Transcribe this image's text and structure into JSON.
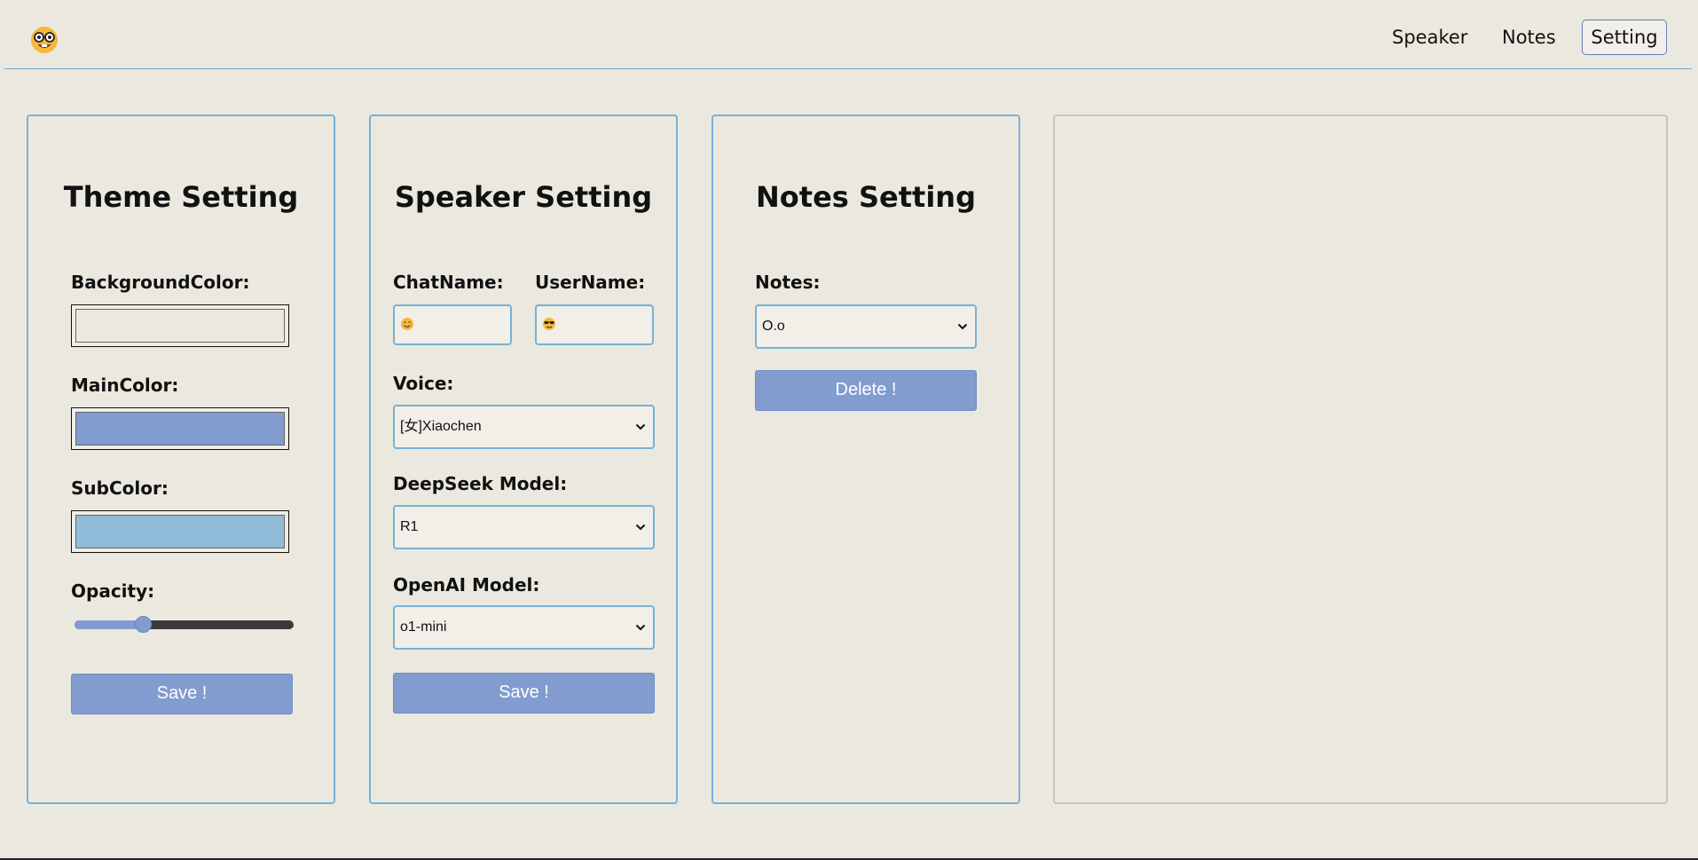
{
  "nav": {
    "items": [
      {
        "label": "Speaker"
      },
      {
        "label": "Notes"
      },
      {
        "label": "Setting",
        "active": true
      }
    ],
    "logo_icon": "nerd-face-icon"
  },
  "theme": {
    "title": "Theme Setting",
    "background_label": "BackgroundColor:",
    "background_color": "#ebe9df",
    "main_label": "MainColor:",
    "main_color": "#839ccf",
    "sub_label": "SubColor:",
    "sub_color": "#8fbdd9",
    "opacity_label": "Opacity:",
    "opacity_value": 0.3,
    "save_label": "Save !"
  },
  "speaker": {
    "title": "Speaker Setting",
    "chatname_label": "ChatName:",
    "chatname_icon": "smiling-face-icon",
    "username_label": "UserName:",
    "username_icon": "sunglasses-face-icon",
    "voice_label": "Voice:",
    "voice_value": "[女]Xiaochen",
    "deepseek_label": "DeepSeek Model:",
    "deepseek_value": "R1",
    "openai_label": "OpenAI Model:",
    "openai_value": "o1-mini",
    "save_label": "Save !"
  },
  "notes": {
    "title": "Notes Setting",
    "notes_label": "Notes:",
    "notes_value": "O.o",
    "delete_label": "Delete !"
  }
}
